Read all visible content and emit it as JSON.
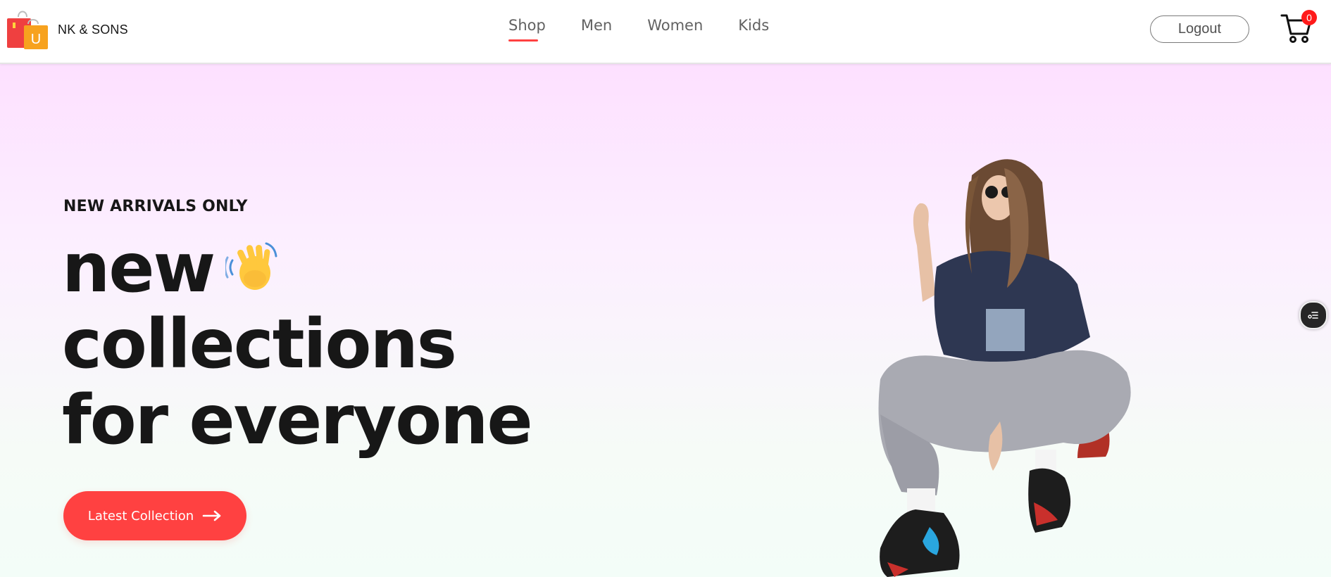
{
  "brand": {
    "name": "NK & SONS",
    "logo_icon": "shopping-bags-logo",
    "logo_letter": "U"
  },
  "nav": {
    "items": [
      {
        "label": "Shop",
        "active": true
      },
      {
        "label": "Men",
        "active": false
      },
      {
        "label": "Women",
        "active": false
      },
      {
        "label": "Kids",
        "active": false
      }
    ]
  },
  "header": {
    "logout_label": "Logout",
    "cart_icon": "cart-icon",
    "cart_count": "0"
  },
  "hero": {
    "eyebrow": "NEW ARRIVALS ONLY",
    "headline": [
      "new",
      "collections",
      "for everyone"
    ],
    "wave_icon": "waving-hand-icon",
    "cta_label": "Latest Collection",
    "cta_icon": "arrow-right-icon",
    "model_image": "model-photo"
  },
  "float_button": {
    "icon": "settings-filter-icon"
  },
  "colors": {
    "accent": "#ff4141",
    "text": "#171717",
    "nav_text": "#626262",
    "hero_top": "#fde0ff",
    "hero_bottom": "#f3fdf8",
    "cart_badge": "#ff1a1a"
  }
}
